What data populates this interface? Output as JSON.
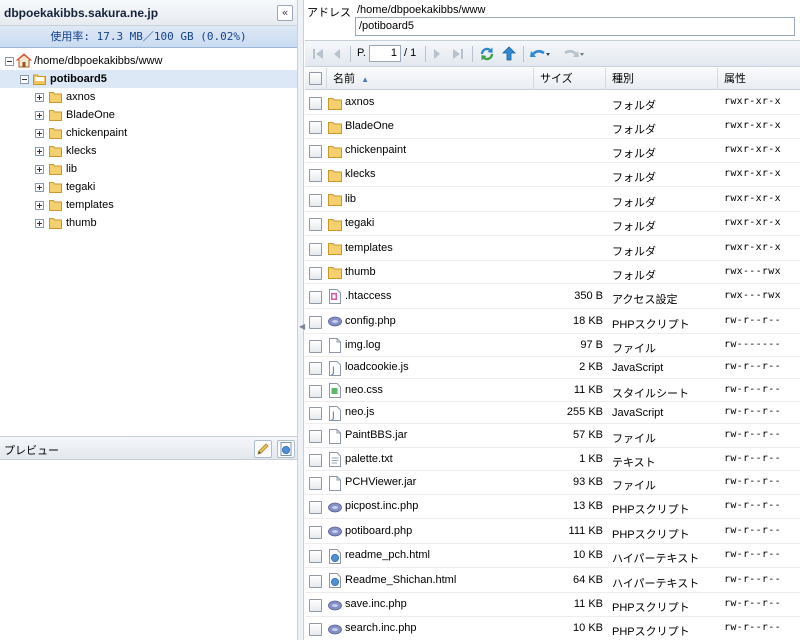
{
  "left_pane": {
    "title": "dbpoekakibbs.sakura.ne.jp",
    "collapse_glyph": "«",
    "usage": "使用率: 17.3 MB／100 GB (0.02%)",
    "tree": {
      "root_label": "/home/dbpoekakibbs/www",
      "current_label": "potiboard5",
      "children": [
        "axnos",
        "BladeOne",
        "chickenpaint",
        "klecks",
        "lib",
        "tegaki",
        "templates",
        "thumb"
      ]
    },
    "preview": {
      "title": "プレビュー"
    }
  },
  "address": {
    "label": "アドレス",
    "path": "/home/dbpoekakibbs/www",
    "value": "/potiboard5"
  },
  "toolbar": {
    "page_prefix": "P.",
    "page_value": "1",
    "page_total": "/ 1"
  },
  "grid": {
    "columns": {
      "name": "名前",
      "sort_indicator": "▲",
      "size": "サイズ",
      "type": "種別",
      "perm": "属性"
    },
    "rows": [
      {
        "name": "axnos",
        "size": "",
        "type": "フォルダ",
        "perm": "rwxr-xr-x",
        "icon": "folder-icon"
      },
      {
        "name": "BladeOne",
        "size": "",
        "type": "フォルダ",
        "perm": "rwxr-xr-x",
        "icon": "folder-icon"
      },
      {
        "name": "chickenpaint",
        "size": "",
        "type": "フォルダ",
        "perm": "rwxr-xr-x",
        "icon": "folder-icon"
      },
      {
        "name": "klecks",
        "size": "",
        "type": "フォルダ",
        "perm": "rwxr-xr-x",
        "icon": "folder-icon"
      },
      {
        "name": "lib",
        "size": "",
        "type": "フォルダ",
        "perm": "rwxr-xr-x",
        "icon": "folder-icon"
      },
      {
        "name": "tegaki",
        "size": "",
        "type": "フォルダ",
        "perm": "rwxr-xr-x",
        "icon": "folder-icon"
      },
      {
        "name": "templates",
        "size": "",
        "type": "フォルダ",
        "perm": "rwxr-xr-x",
        "icon": "folder-icon"
      },
      {
        "name": "thumb",
        "size": "",
        "type": "フォルダ",
        "perm": "rwx---rwx",
        "icon": "folder-icon"
      },
      {
        "name": ".htaccess",
        "size": "350 B",
        "type": "アクセス設定",
        "perm": "rwx---rwx",
        "icon": "htaccess-icon"
      },
      {
        "name": "config.php",
        "size": "18 KB",
        "type": "PHPスクリプト",
        "perm": "rw-r--r--",
        "icon": "php-icon"
      },
      {
        "name": "img.log",
        "size": "97 B",
        "type": "ファイル",
        "perm": "rw-------",
        "icon": "file-icon"
      },
      {
        "name": "loadcookie.js",
        "size": "2 KB",
        "type": "JavaScript",
        "perm": "rw-r--r--",
        "icon": "js-icon"
      },
      {
        "name": "neo.css",
        "size": "11 KB",
        "type": "スタイルシート",
        "perm": "rw-r--r--",
        "icon": "css-icon"
      },
      {
        "name": "neo.js",
        "size": "255 KB",
        "type": "JavaScript",
        "perm": "rw-r--r--",
        "icon": "js-icon"
      },
      {
        "name": "PaintBBS.jar",
        "size": "57 KB",
        "type": "ファイル",
        "perm": "rw-r--r--",
        "icon": "file-icon"
      },
      {
        "name": "palette.txt",
        "size": "1 KB",
        "type": "テキスト",
        "perm": "rw-r--r--",
        "icon": "text-icon"
      },
      {
        "name": "PCHViewer.jar",
        "size": "93 KB",
        "type": "ファイル",
        "perm": "rw-r--r--",
        "icon": "file-icon"
      },
      {
        "name": "picpost.inc.php",
        "size": "13 KB",
        "type": "PHPスクリプト",
        "perm": "rw-r--r--",
        "icon": "php-icon"
      },
      {
        "name": "potiboard.php",
        "size": "111 KB",
        "type": "PHPスクリプト",
        "perm": "rw-r--r--",
        "icon": "php-icon"
      },
      {
        "name": "readme_pch.html",
        "size": "10 KB",
        "type": "ハイパーテキスト",
        "perm": "rw-r--r--",
        "icon": "html-icon"
      },
      {
        "name": "Readme_Shichan.html",
        "size": "64 KB",
        "type": "ハイパーテキスト",
        "perm": "rw-r--r--",
        "icon": "html-icon"
      },
      {
        "name": "save.inc.php",
        "size": "11 KB",
        "type": "PHPスクリプト",
        "perm": "rw-r--r--",
        "icon": "php-icon"
      },
      {
        "name": "search.inc.php",
        "size": "10 KB",
        "type": "PHPスクリプト",
        "perm": "rw-r--r--",
        "icon": "php-icon"
      }
    ]
  }
}
